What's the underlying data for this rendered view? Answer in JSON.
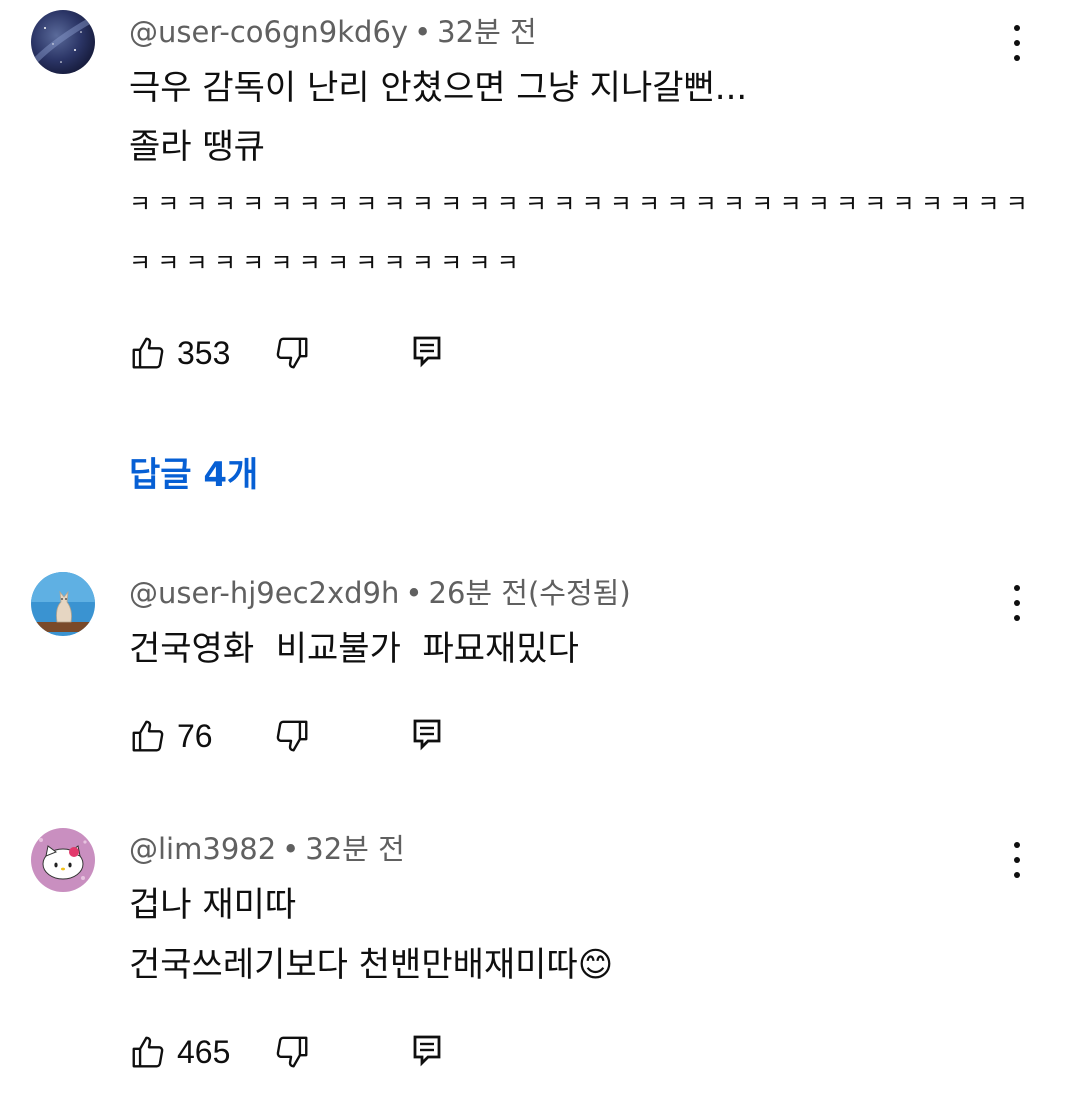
{
  "comments": [
    {
      "handle": "@user-co6gn9kd6y",
      "separator": "•",
      "time": "32분 전",
      "lines": [
        "극우 감독이 난리 안쳤으면 그냥 지나갈뻔...",
        "졸라 땡큐",
        "ㅋㅋㅋㅋㅋㅋㅋㅋㅋㅋㅋㅋㅋㅋㅋㅋㅋㅋㅋㅋㅋㅋㅋㅋㅋㅋㅋㅋㅋㅋㅋㅋ",
        "ㅋㅋㅋㅋㅋㅋㅋㅋㅋㅋㅋㅋㅋㅋ"
      ],
      "likes": "353",
      "replies_label": "답글 4개",
      "avatar_icon": "night-sky-avatar"
    },
    {
      "handle": "@user-hj9ec2xd9h",
      "separator": "•",
      "time": "26분 전(수정됨)",
      "lines": [
        "건국영화  비교불가  파묘재밌다"
      ],
      "likes": "76",
      "avatar_icon": "cat-avatar"
    },
    {
      "handle": "@lim3982",
      "separator": "•",
      "time": "32분 전",
      "lines": [
        "겁나 재미따",
        "건국쓰레기보다 천밴만배재미따"
      ],
      "emoji": "😊",
      "likes": "465",
      "avatar_icon": "hello-kitty-avatar"
    }
  ],
  "colors": {
    "text": "#0f0f0f",
    "meta": "#606060",
    "link": "#065fd4"
  }
}
